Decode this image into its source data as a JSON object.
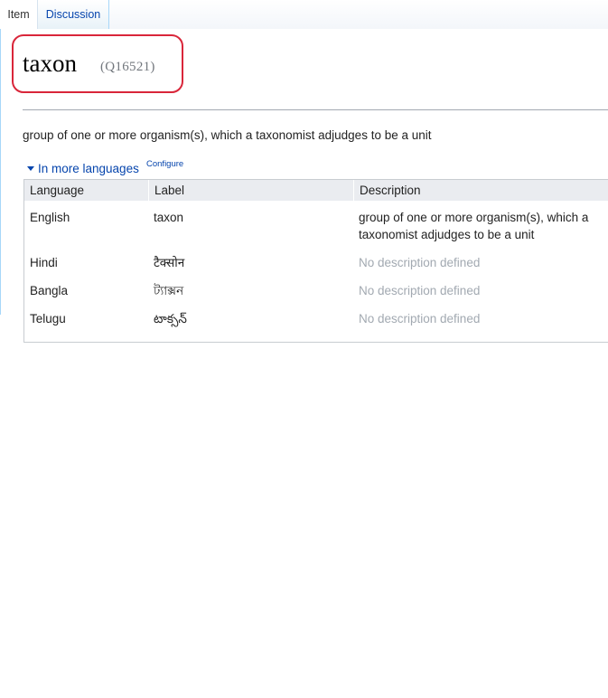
{
  "tabs": [
    {
      "label": "Item"
    },
    {
      "label": "Discussion"
    }
  ],
  "entity": {
    "title": "taxon",
    "id": "(Q16521)",
    "description": "group of one or more organism(s), which a taxonomist adjudges to be a unit"
  },
  "languages_section": {
    "toggle_label": "In more languages",
    "configure_label": "Configure",
    "columns": [
      "Language",
      "Label",
      "Description"
    ],
    "rows": [
      {
        "language": "English",
        "label": "taxon",
        "description": "group of one or more organism(s), which a taxonomist adjudges to be a unit",
        "has_description": true
      },
      {
        "language": "Hindi",
        "label": "टैक्सोन",
        "description": "No description defined",
        "has_description": false
      },
      {
        "language": "Bangla",
        "label": "ট্যাক্সন",
        "description": "No description defined",
        "has_description": false
      },
      {
        "language": "Telugu",
        "label": "టాక్సన్",
        "description": "No description defined",
        "has_description": false
      }
    ]
  },
  "colors": {
    "link": "#0645ad",
    "highlight_box": "#d9263a",
    "muted": "#a2a9b1",
    "header_bg": "#eaecf0",
    "tab_border": "#a7d7f9"
  },
  "icons": {
    "toggle": "triangle-down-icon"
  }
}
